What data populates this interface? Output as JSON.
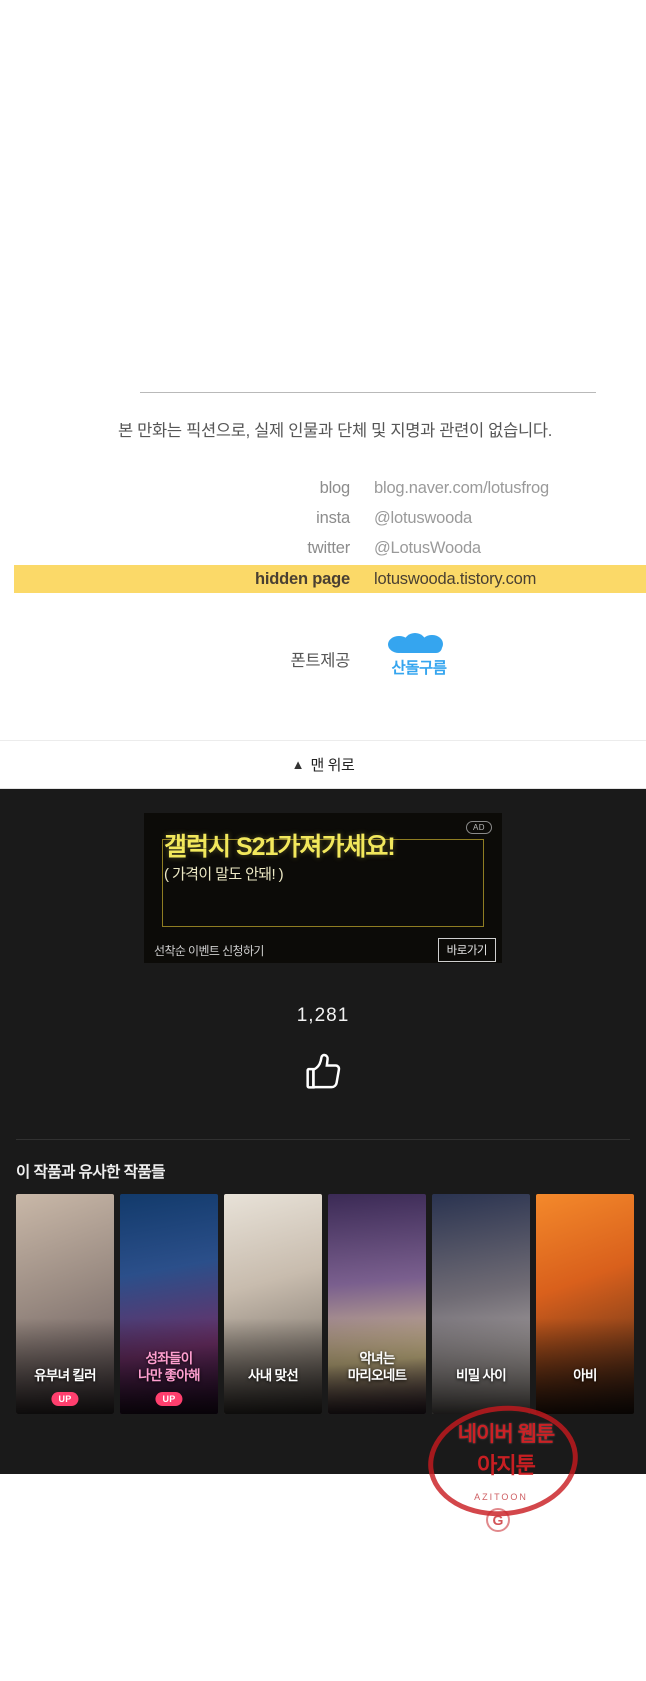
{
  "footer_credits": {
    "fiction_note": "본 만화는 픽션으로, 실제 인물과 단체 및 지명과 관련이 없습니다.",
    "links": [
      {
        "key": "blog",
        "value": "blog.naver.com/lotusfrog",
        "highlight": false
      },
      {
        "key": "insta",
        "value": "@lotuswooda",
        "highlight": false
      },
      {
        "key": "twitter",
        "value": "@LotusWooda",
        "highlight": false
      },
      {
        "key": "hidden page",
        "value": "lotuswooda.tistory.com",
        "highlight": true
      }
    ],
    "highlight_color": "#fbd968",
    "font_provider_label": "폰트제공",
    "font_provider_name": "산돌구름",
    "font_provider_color": "#35a5ef"
  },
  "back_to_top": {
    "chevron_icon": "chevron-up-icon",
    "label": "맨 위로"
  },
  "ad": {
    "badge": "AD",
    "title": "갤럭시 S21가져가세요!",
    "subtitle": "( 가격이 말도 안돼! )",
    "footer_text": "선착순 이벤트 신청하기",
    "cta_label": "바로가기",
    "title_color": "#f2e85c",
    "background_color": "#0c0b08"
  },
  "like": {
    "count": "1,281",
    "icon": "thumbs-up-icon"
  },
  "similar_works": {
    "section_title": "이 작품과 유사한 작품들",
    "items": [
      {
        "title": "유부녀 킬러",
        "badge": "UP",
        "title_color": "#ffffff"
      },
      {
        "title": "성좌들이\n나만 좋아해",
        "badge": "UP",
        "title_color": "#ff9fd0"
      },
      {
        "title": "사내 맞선",
        "badge": "",
        "title_color": "#ffffff"
      },
      {
        "title": "악녀는\n마리오네트",
        "badge": "",
        "title_color": "#ffffff"
      },
      {
        "title": "비밀 사이",
        "badge": "",
        "title_color": "#ffffff"
      },
      {
        "title": "아비",
        "badge": "",
        "title_color": "#ffffff"
      }
    ]
  },
  "watermark": {
    "line1": "네이버 웹툰",
    "line2": "아지툰",
    "small": "AZITOON",
    "mark": "G",
    "color": "#d71e23"
  }
}
